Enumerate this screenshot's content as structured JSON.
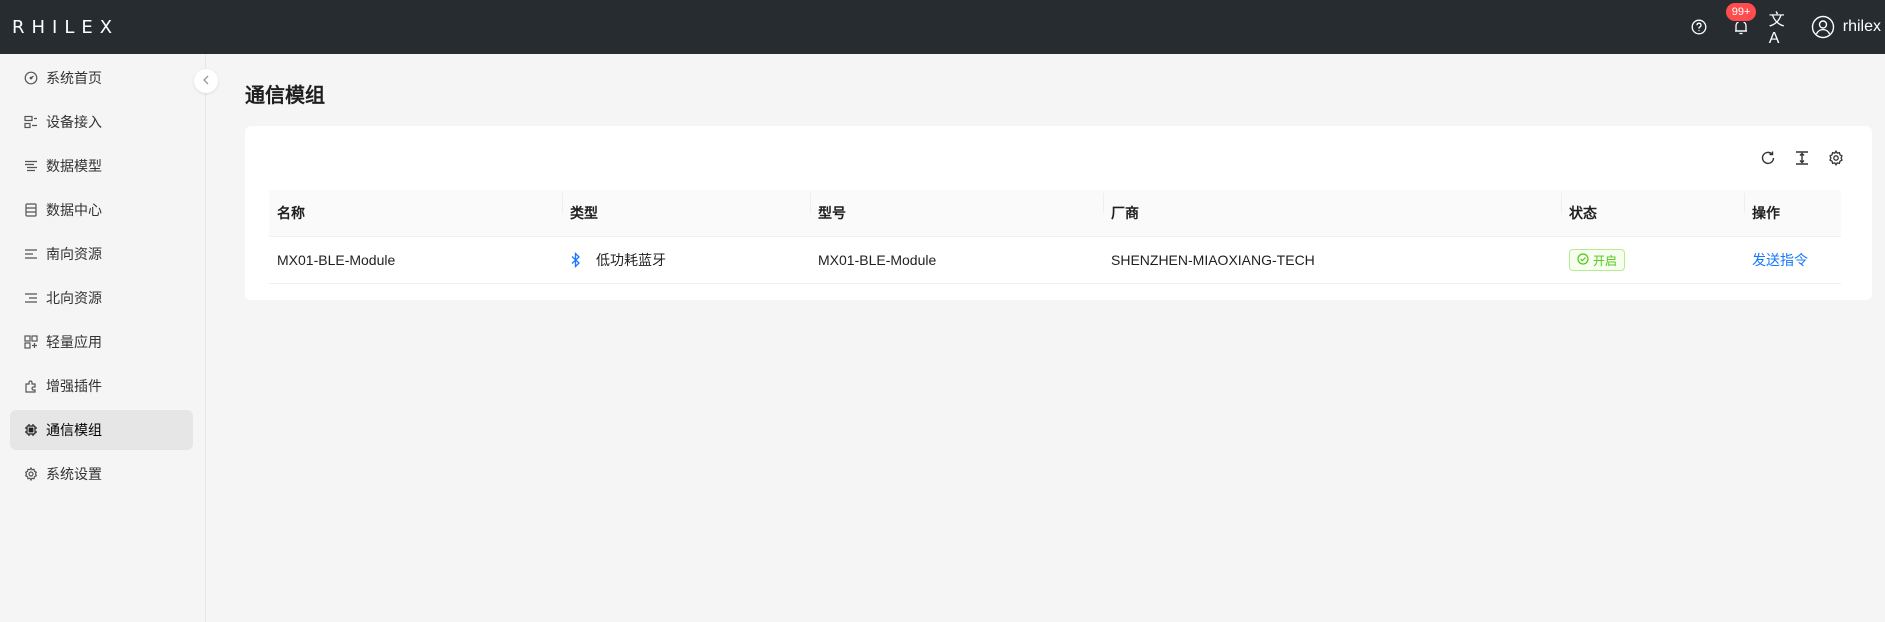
{
  "topbar": {
    "logo": "RHILEX",
    "notification_badge": "99+",
    "translate_glyph": "文A",
    "username": "rhilex"
  },
  "sidebar": {
    "items": [
      {
        "label": "系统首页",
        "icon": "dashboard-icon",
        "active": false
      },
      {
        "label": "设备接入",
        "icon": "device-icon",
        "active": false
      },
      {
        "label": "数据模型",
        "icon": "datamodel-icon",
        "active": false
      },
      {
        "label": "数据中心",
        "icon": "database-icon",
        "active": false
      },
      {
        "label": "南向资源",
        "icon": "south-resource-icon",
        "active": false
      },
      {
        "label": "北向资源",
        "icon": "north-resource-icon",
        "active": false
      },
      {
        "label": "轻量应用",
        "icon": "app-icon",
        "active": false
      },
      {
        "label": "增强插件",
        "icon": "plugin-icon",
        "active": false
      },
      {
        "label": "通信模组",
        "icon": "chip-icon",
        "active": true
      },
      {
        "label": "系统设置",
        "icon": "settings-icon",
        "active": false
      }
    ]
  },
  "main": {
    "title": "通信模组",
    "toolbar_icons": [
      "reload-icon",
      "column-height-icon",
      "setting-icon"
    ],
    "table": {
      "headers": [
        "名称",
        "类型",
        "型号",
        "厂商",
        "状态",
        "操作"
      ],
      "rows": [
        {
          "name": "MX01-BLE-Module",
          "type": "低功耗蓝牙",
          "model": "MX01-BLE-Module",
          "vendor": "SHENZHEN-MIAOXIANG-TECH",
          "status": "开启",
          "action": "发送指令"
        }
      ]
    }
  },
  "colors": {
    "topbar_bg": "#272c30",
    "accent": "#1677ff",
    "status_green": "#52c41a",
    "badge_red": "#ff4d4f"
  }
}
